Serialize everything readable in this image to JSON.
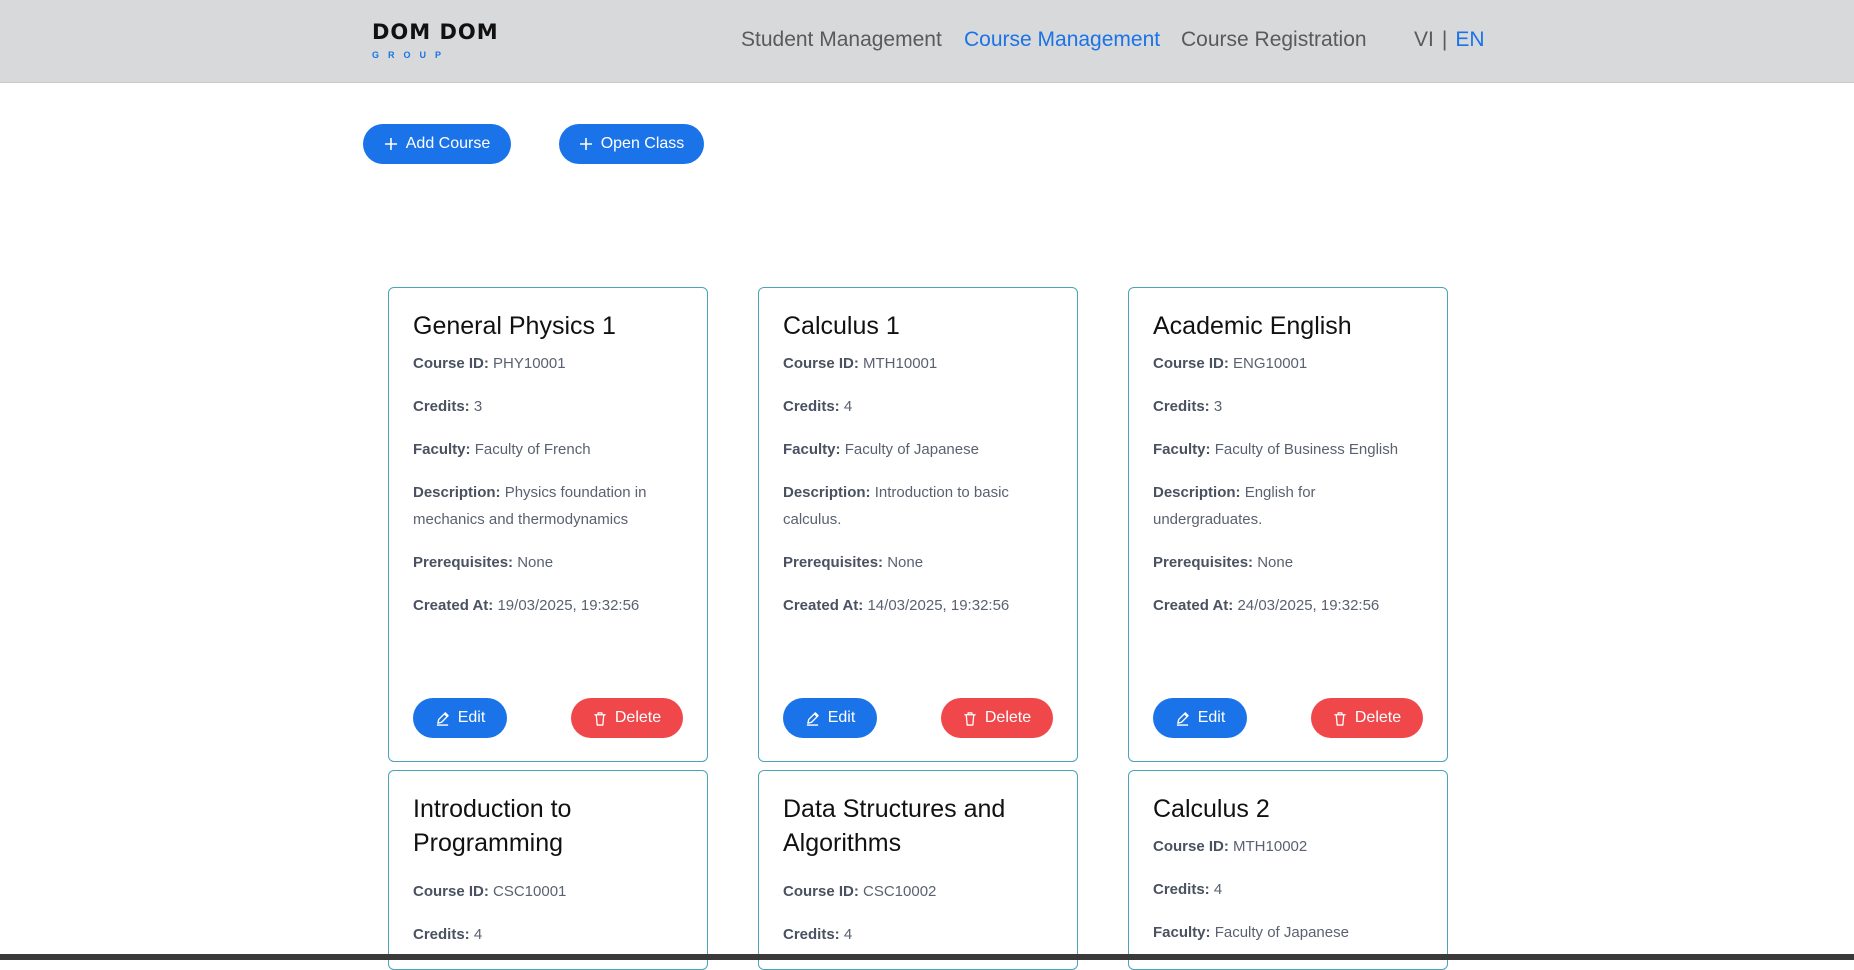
{
  "header": {
    "logo_main": "DOM DOM",
    "logo_sub": "GROUP",
    "nav": [
      {
        "label": "Student Management",
        "active": false
      },
      {
        "label": "Course Management",
        "active": true
      },
      {
        "label": "Course Registration",
        "active": false
      }
    ],
    "lang": {
      "vi": "VI",
      "separator": "|",
      "en": "EN",
      "active": "EN"
    }
  },
  "actions": {
    "add_course": "Add Course",
    "open_class": "Open Class"
  },
  "labels": {
    "course_id": "Course ID:",
    "credits": "Credits:",
    "faculty": "Faculty:",
    "description": "Description:",
    "prerequisites": "Prerequisites:",
    "created_at": "Created At:",
    "edit": "Edit",
    "delete": "Delete"
  },
  "courses": [
    {
      "name": "General Physics 1",
      "id": "PHY10001",
      "credits": "3",
      "faculty": "Faculty of French",
      "description": "Physics foundation in mechanics and thermodynamics",
      "prerequisites": "None",
      "created_at": "19/03/2025, 19:32:56"
    },
    {
      "name": "Calculus 1",
      "id": "MTH10001",
      "credits": "4",
      "faculty": "Faculty of Japanese",
      "description": "Introduction to basic calculus.",
      "prerequisites": "None",
      "created_at": "14/03/2025, 19:32:56"
    },
    {
      "name": "Academic English",
      "id": "ENG10001",
      "credits": "3",
      "faculty": "Faculty of Business English",
      "description": "English for undergraduates.",
      "prerequisites": "None",
      "created_at": "24/03/2025, 19:32:56"
    },
    {
      "name": "Introduction to Programming",
      "id": "CSC10001",
      "credits": "4"
    },
    {
      "name": "Data Structures and Algorithms",
      "id": "CSC10002",
      "credits": "4"
    },
    {
      "name": "Calculus 2",
      "id": "MTH10002",
      "credits": "4",
      "faculty": "Faculty of Japanese"
    }
  ],
  "colors": {
    "primary": "#1a73e8",
    "danger": "#f0474b",
    "card_border": "#4aa3b8",
    "header_bg": "#d8d9da"
  }
}
